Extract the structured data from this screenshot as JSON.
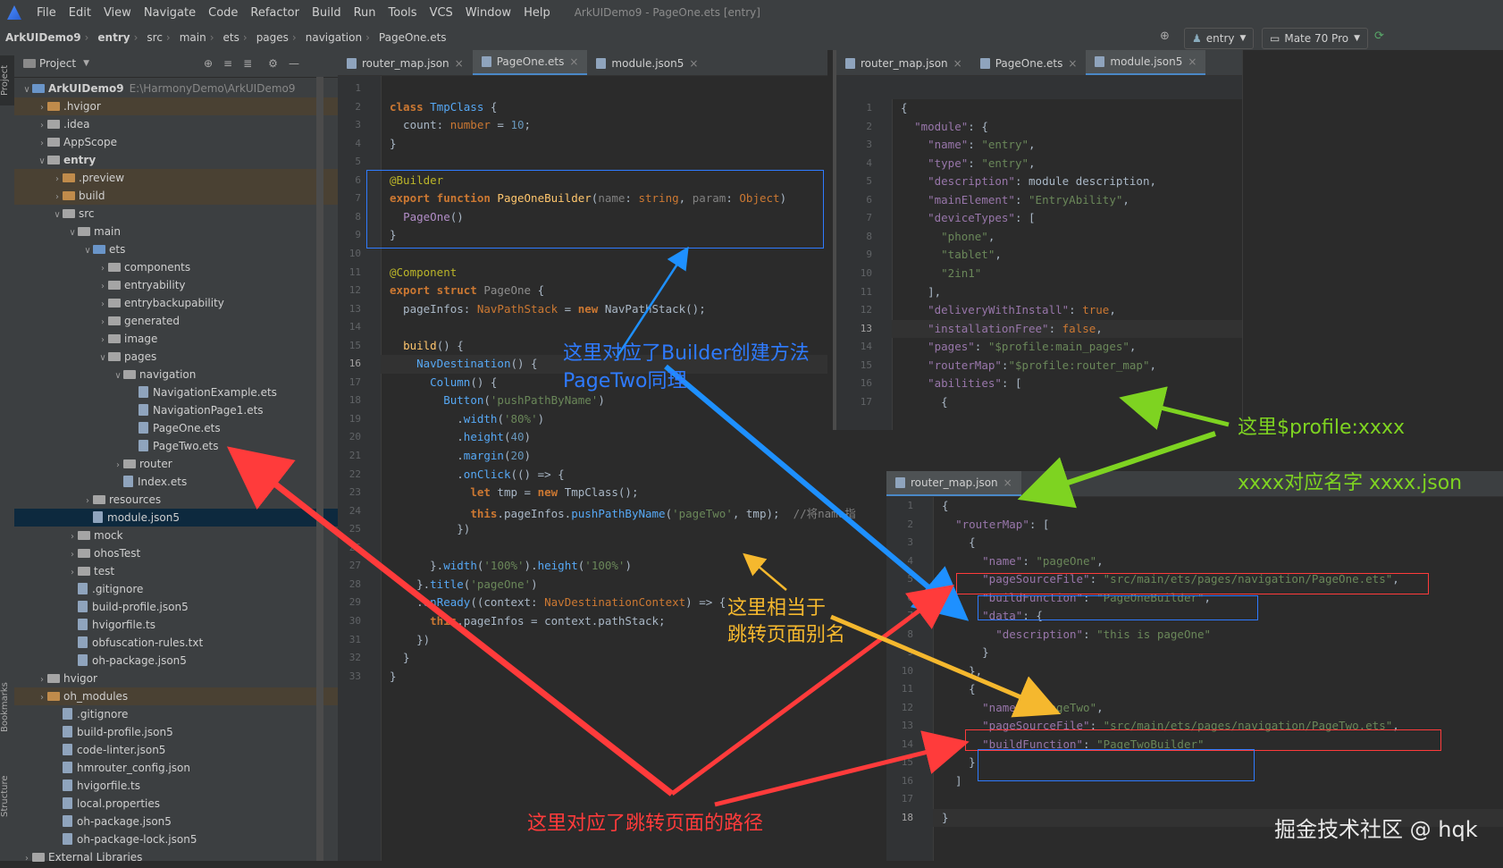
{
  "menu": {
    "items": [
      "File",
      "Edit",
      "View",
      "Navigate",
      "Code",
      "Refactor",
      "Build",
      "Run",
      "Tools",
      "VCS",
      "Window",
      "Help"
    ],
    "title": "ArkUIDemo9 - PageOne.ets [entry]"
  },
  "breadcrumb": [
    "ArkUIDemo9",
    "entry",
    "src",
    "main",
    "ets",
    "pages",
    "navigation",
    "PageOne.ets"
  ],
  "toolbar": {
    "run_config": "entry",
    "device": "Mate 70 Pro"
  },
  "side_tabs": {
    "project": "Project",
    "bookmarks": "Bookmarks",
    "structure": "Structure"
  },
  "project": {
    "header": "Project",
    "tree": [
      {
        "label": "ArkUIDemo9",
        "path": "E:\\HarmonyDemo\\ArkUIDemo9",
        "indent": 0,
        "open": true,
        "kind": "folder-blue",
        "bold": true
      },
      {
        "label": ".hvigor",
        "indent": 1,
        "open": false,
        "kind": "folder-orange",
        "hl": true
      },
      {
        "label": ".idea",
        "indent": 1,
        "open": false,
        "kind": "folder"
      },
      {
        "label": "AppScope",
        "indent": 1,
        "open": false,
        "kind": "folder"
      },
      {
        "label": "entry",
        "indent": 1,
        "open": true,
        "kind": "folder",
        "bold": true
      },
      {
        "label": ".preview",
        "indent": 2,
        "open": false,
        "kind": "folder-orange",
        "hl": true
      },
      {
        "label": "build",
        "indent": 2,
        "open": false,
        "kind": "folder-orange",
        "hl": true
      },
      {
        "label": "src",
        "indent": 2,
        "open": true,
        "kind": "folder"
      },
      {
        "label": "main",
        "indent": 3,
        "open": true,
        "kind": "folder"
      },
      {
        "label": "ets",
        "indent": 4,
        "open": true,
        "kind": "folder-blue"
      },
      {
        "label": "components",
        "indent": 5,
        "open": false,
        "kind": "folder"
      },
      {
        "label": "entryability",
        "indent": 5,
        "open": false,
        "kind": "folder"
      },
      {
        "label": "entrybackupability",
        "indent": 5,
        "open": false,
        "kind": "folder"
      },
      {
        "label": "generated",
        "indent": 5,
        "open": false,
        "kind": "folder"
      },
      {
        "label": "image",
        "indent": 5,
        "open": false,
        "kind": "folder"
      },
      {
        "label": "pages",
        "indent": 5,
        "open": true,
        "kind": "folder"
      },
      {
        "label": "navigation",
        "indent": 6,
        "open": true,
        "kind": "folder"
      },
      {
        "label": "NavigationExample.ets",
        "indent": 7,
        "kind": "file"
      },
      {
        "label": "NavigationPage1.ets",
        "indent": 7,
        "kind": "file"
      },
      {
        "label": "PageOne.ets",
        "indent": 7,
        "kind": "file"
      },
      {
        "label": "PageTwo.ets",
        "indent": 7,
        "kind": "file"
      },
      {
        "label": "router",
        "indent": 6,
        "open": false,
        "kind": "folder"
      },
      {
        "label": "Index.ets",
        "indent": 6,
        "kind": "file"
      },
      {
        "label": "resources",
        "indent": 4,
        "open": false,
        "kind": "folder"
      },
      {
        "label": "module.json5",
        "indent": 4,
        "kind": "file",
        "sel": true
      },
      {
        "label": "mock",
        "indent": 3,
        "open": false,
        "kind": "folder"
      },
      {
        "label": "ohosTest",
        "indent": 3,
        "open": false,
        "kind": "folder"
      },
      {
        "label": "test",
        "indent": 3,
        "open": false,
        "kind": "folder"
      },
      {
        "label": ".gitignore",
        "indent": 3,
        "kind": "file"
      },
      {
        "label": "build-profile.json5",
        "indent": 3,
        "kind": "file"
      },
      {
        "label": "hvigorfile.ts",
        "indent": 3,
        "kind": "file"
      },
      {
        "label": "obfuscation-rules.txt",
        "indent": 3,
        "kind": "file"
      },
      {
        "label": "oh-package.json5",
        "indent": 3,
        "kind": "file"
      },
      {
        "label": "hvigor",
        "indent": 1,
        "open": false,
        "kind": "folder"
      },
      {
        "label": "oh_modules",
        "indent": 1,
        "open": false,
        "kind": "folder-orange",
        "hl": true
      },
      {
        "label": ".gitignore",
        "indent": 2,
        "kind": "file"
      },
      {
        "label": "build-profile.json5",
        "indent": 2,
        "kind": "file"
      },
      {
        "label": "code-linter.json5",
        "indent": 2,
        "kind": "file"
      },
      {
        "label": "hmrouter_config.json",
        "indent": 2,
        "kind": "file"
      },
      {
        "label": "hvigorfile.ts",
        "indent": 2,
        "kind": "file"
      },
      {
        "label": "local.properties",
        "indent": 2,
        "kind": "file"
      },
      {
        "label": "oh-package.json5",
        "indent": 2,
        "kind": "file"
      },
      {
        "label": "oh-package-lock.json5",
        "indent": 2,
        "kind": "file"
      },
      {
        "label": "External Libraries",
        "indent": 0,
        "open": false,
        "kind": "lib"
      }
    ]
  },
  "editor1": {
    "tabs": [
      {
        "label": "router_map.json"
      },
      {
        "label": "PageOne.ets",
        "active": true
      },
      {
        "label": "module.json5"
      }
    ],
    "current_line": 16,
    "lines": [
      [],
      [
        [
          "kw",
          "class "
        ],
        [
          "ty",
          "TmpClass"
        ],
        [
          "t",
          " {"
        ]
      ],
      [
        [
          "t",
          "  count: "
        ],
        [
          "kwn",
          "number"
        ],
        [
          "t",
          " = "
        ],
        [
          "num",
          "10"
        ],
        [
          "t",
          ";"
        ]
      ],
      [
        [
          "t",
          "}"
        ]
      ],
      [],
      [
        [
          "ann",
          "@Builder"
        ]
      ],
      [
        [
          "kw",
          "export function "
        ],
        [
          "fn",
          "PageOneBuilder"
        ],
        [
          "t",
          "("
        ],
        [
          "prm",
          "name"
        ],
        [
          "t",
          ": "
        ],
        [
          "kwn",
          "string"
        ],
        [
          "t",
          ", "
        ],
        [
          "prm",
          "param"
        ],
        [
          "t",
          ": "
        ],
        [
          "kwn",
          "Object"
        ],
        [
          "t",
          ")"
        ]
      ],
      [
        [
          "t",
          "  "
        ],
        [
          "mf",
          "PageOne"
        ],
        [
          "t",
          "()"
        ]
      ],
      [
        [
          "t",
          "}"
        ]
      ],
      [],
      [
        [
          "ann",
          "@Component"
        ]
      ],
      [
        [
          "kw",
          "export struct "
        ],
        [
          "mute",
          "PageOne"
        ],
        [
          "t",
          " {"
        ]
      ],
      [
        [
          "t",
          "  pageInfos: "
        ],
        [
          "kwn",
          "NavPathStack"
        ],
        [
          "t",
          " = "
        ],
        [
          "kw",
          "new "
        ],
        [
          "t",
          "NavPathStack();"
        ]
      ],
      [],
      [
        [
          "t",
          "  "
        ],
        [
          "fn",
          "build"
        ],
        [
          "t",
          "() {"
        ]
      ],
      [
        [
          "t",
          "    "
        ],
        [
          "ty",
          "NavDestination"
        ],
        [
          "t",
          "() {"
        ]
      ],
      [
        [
          "t",
          "      "
        ],
        [
          "ty",
          "Column"
        ],
        [
          "t",
          "() {"
        ]
      ],
      [
        [
          "t",
          "        "
        ],
        [
          "ty",
          "Button"
        ],
        [
          "t",
          "("
        ],
        [
          "str",
          "'pushPathByName'"
        ],
        [
          "t",
          ")"
        ]
      ],
      [
        [
          "t",
          "          ."
        ],
        [
          "ty",
          "width"
        ],
        [
          "t",
          "("
        ],
        [
          "str",
          "'80%'"
        ],
        [
          "t",
          ")"
        ]
      ],
      [
        [
          "t",
          "          ."
        ],
        [
          "ty",
          "height"
        ],
        [
          "t",
          "("
        ],
        [
          "num",
          "40"
        ],
        [
          "t",
          ")"
        ]
      ],
      [
        [
          "t",
          "          ."
        ],
        [
          "ty",
          "margin"
        ],
        [
          "t",
          "("
        ],
        [
          "num",
          "20"
        ],
        [
          "t",
          ")"
        ]
      ],
      [
        [
          "t",
          "          ."
        ],
        [
          "ty",
          "onClick"
        ],
        [
          "t",
          "(() => {"
        ]
      ],
      [
        [
          "t",
          "            "
        ],
        [
          "kw",
          "let "
        ],
        [
          "t",
          "tmp = "
        ],
        [
          "kw",
          "new "
        ],
        [
          "t",
          "TmpClass();"
        ]
      ],
      [
        [
          "t",
          "            "
        ],
        [
          "kw",
          "this"
        ],
        [
          "t",
          ".pageInfos."
        ],
        [
          "ty",
          "pushPathByName"
        ],
        [
          "t",
          "("
        ],
        [
          "str",
          "'pageTwo'"
        ],
        [
          "t",
          ", tmp);  "
        ],
        [
          "cmt",
          "//将name指"
        ]
      ],
      [
        [
          "t",
          "          })"
        ]
      ],
      [],
      [
        [
          "t",
          "      }."
        ],
        [
          "ty",
          "width"
        ],
        [
          "t",
          "("
        ],
        [
          "str",
          "'100%'"
        ],
        [
          "t",
          ")."
        ],
        [
          "ty",
          "height"
        ],
        [
          "t",
          "("
        ],
        [
          "str",
          "'100%'"
        ],
        [
          "t",
          ")"
        ]
      ],
      [
        [
          "t",
          "    }."
        ],
        [
          "ty",
          "title"
        ],
        [
          "t",
          "("
        ],
        [
          "str",
          "'pageOne'"
        ],
        [
          "t",
          ")"
        ]
      ],
      [
        [
          "t",
          "    ."
        ],
        [
          "ty",
          "onReady"
        ],
        [
          "t",
          "((context: "
        ],
        [
          "kwn",
          "NavDestinationContext"
        ],
        [
          "t",
          ") => {"
        ]
      ],
      [
        [
          "t",
          "      "
        ],
        [
          "kw",
          "this"
        ],
        [
          "t",
          ".pageInfos = context.pathStack;"
        ]
      ],
      [
        [
          "t",
          "    })"
        ]
      ],
      [
        [
          "t",
          "  }"
        ]
      ],
      [
        [
          "t",
          "}"
        ]
      ]
    ]
  },
  "editor2": {
    "tabs": [
      {
        "label": "router_map.json"
      },
      {
        "label": "PageOne.ets"
      },
      {
        "label": "module.json5",
        "active": true
      }
    ],
    "current_line": 13,
    "lines": [
      [
        [
          "t",
          "{"
        ]
      ],
      [
        [
          "t",
          "  "
        ],
        [
          "key",
          "\"module\""
        ],
        [
          "t",
          ": {"
        ]
      ],
      [
        [
          "t",
          "    "
        ],
        [
          "key",
          "\"name\""
        ],
        [
          "t",
          ": "
        ],
        [
          "str",
          "\"entry\""
        ],
        [
          "t",
          ","
        ]
      ],
      [
        [
          "t",
          "    "
        ],
        [
          "key",
          "\"type\""
        ],
        [
          "t",
          ": "
        ],
        [
          "str",
          "\"entry\""
        ],
        [
          "t",
          ","
        ]
      ],
      [
        [
          "t",
          "    "
        ],
        [
          "key",
          "\"description\""
        ],
        [
          "t",
          ": "
        ],
        [
          "t",
          "module description"
        ],
        [
          "t",
          ","
        ]
      ],
      [
        [
          "t",
          "    "
        ],
        [
          "key",
          "\"mainElement\""
        ],
        [
          "t",
          ": "
        ],
        [
          "str",
          "\"EntryAbility\""
        ],
        [
          "t",
          ","
        ]
      ],
      [
        [
          "t",
          "    "
        ],
        [
          "key",
          "\"deviceTypes\""
        ],
        [
          "t",
          ": ["
        ]
      ],
      [
        [
          "t",
          "      "
        ],
        [
          "str",
          "\"phone\""
        ],
        [
          "t",
          ","
        ]
      ],
      [
        [
          "t",
          "      "
        ],
        [
          "str",
          "\"tablet\""
        ],
        [
          "t",
          ","
        ]
      ],
      [
        [
          "t",
          "      "
        ],
        [
          "str",
          "\"2in1\""
        ]
      ],
      [
        [
          "t",
          "    ],"
        ]
      ],
      [
        [
          "t",
          "    "
        ],
        [
          "key",
          "\"deliveryWithInstall\""
        ],
        [
          "t",
          ": "
        ],
        [
          "kwn",
          "true"
        ],
        [
          "t",
          ","
        ]
      ],
      [
        [
          "t",
          "    "
        ],
        [
          "key",
          "\"installationFree\""
        ],
        [
          "t",
          ": "
        ],
        [
          "kwn",
          "false"
        ],
        [
          "t",
          ","
        ]
      ],
      [
        [
          "t",
          "    "
        ],
        [
          "key",
          "\"pages\""
        ],
        [
          "t",
          ": "
        ],
        [
          "str",
          "\"$profile:main_pages\""
        ],
        [
          "t",
          ","
        ]
      ],
      [
        [
          "t",
          "    "
        ],
        [
          "key",
          "\"routerMap\""
        ],
        [
          "t",
          ":"
        ],
        [
          "str",
          "\"$profile:router_map\""
        ],
        [
          "t",
          ","
        ]
      ],
      [
        [
          "t",
          "    "
        ],
        [
          "key",
          "\"abilities\""
        ],
        [
          "t",
          ": ["
        ]
      ],
      [
        [
          "t",
          "      {"
        ]
      ]
    ]
  },
  "editor3": {
    "tabs": [
      {
        "label": "router_map.json",
        "active": true
      }
    ],
    "current_line": 18,
    "lines": [
      [
        [
          "t",
          "{"
        ]
      ],
      [
        [
          "t",
          "  "
        ],
        [
          "key",
          "\"routerMap\""
        ],
        [
          "t",
          ": ["
        ]
      ],
      [
        [
          "t",
          "    {"
        ]
      ],
      [
        [
          "t",
          "      "
        ],
        [
          "key",
          "\"name\""
        ],
        [
          "t",
          ": "
        ],
        [
          "str",
          "\"pageOne\""
        ],
        [
          "t",
          ","
        ]
      ],
      [
        [
          "t",
          "      "
        ],
        [
          "key",
          "\"pageSourceFile\""
        ],
        [
          "t",
          ": "
        ],
        [
          "str",
          "\"src/main/ets/pages/navigation/PageOne.ets\""
        ],
        [
          "t",
          ","
        ]
      ],
      [
        [
          "t",
          "      "
        ],
        [
          "key",
          "\"buildFunction\""
        ],
        [
          "t",
          ": "
        ],
        [
          "str",
          "\"PageOneBuilder\""
        ],
        [
          "t",
          ","
        ]
      ],
      [
        [
          "t",
          "      "
        ],
        [
          "key",
          "\"data\""
        ],
        [
          "t",
          ": {"
        ]
      ],
      [
        [
          "t",
          "        "
        ],
        [
          "key",
          "\"description\""
        ],
        [
          "t",
          ": "
        ],
        [
          "str",
          "\"this is pageOne\""
        ]
      ],
      [
        [
          "t",
          "      }"
        ]
      ],
      [
        [
          "t",
          "    },"
        ]
      ],
      [
        [
          "t",
          "    {"
        ]
      ],
      [
        [
          "t",
          "      "
        ],
        [
          "key",
          "\"name\""
        ],
        [
          "t",
          ": "
        ],
        [
          "str",
          "\"pageTwo\""
        ],
        [
          "t",
          ","
        ]
      ],
      [
        [
          "t",
          "      "
        ],
        [
          "key",
          "\"pageSourceFile\""
        ],
        [
          "t",
          ": "
        ],
        [
          "str",
          "\"src/main/ets/pages/navigation/PageTwo.ets\""
        ],
        [
          "t",
          ","
        ]
      ],
      [
        [
          "t",
          "      "
        ],
        [
          "key",
          "\"buildFunction\""
        ],
        [
          "t",
          ": "
        ],
        [
          "str",
          "\"PageTwoBuilder\""
        ]
      ],
      [
        [
          "t",
          "    }"
        ]
      ],
      [
        [
          "t",
          "  ]"
        ]
      ],
      [],
      [
        [
          "t",
          "}"
        ]
      ]
    ]
  },
  "annotations": {
    "builder_line1": "这里对应了Builder创建方法",
    "builder_line2": "PageTwo同理",
    "alias_line1": "这里相当于",
    "alias_line2": "跳转页面别名",
    "profile_line1": "这里$profile:xxxx",
    "profile_line2": "xxxx对应名字 xxxx.json",
    "path": "这里对应了跳转页面的路径"
  },
  "watermark": "掘金技术社区 @ hqk",
  "colors": {
    "blue": "#1e90ff",
    "red": "#ff3b3b",
    "yellow": "#f5b82e",
    "green": "#7ed321",
    "annotation_blue": "#2f7bff"
  }
}
